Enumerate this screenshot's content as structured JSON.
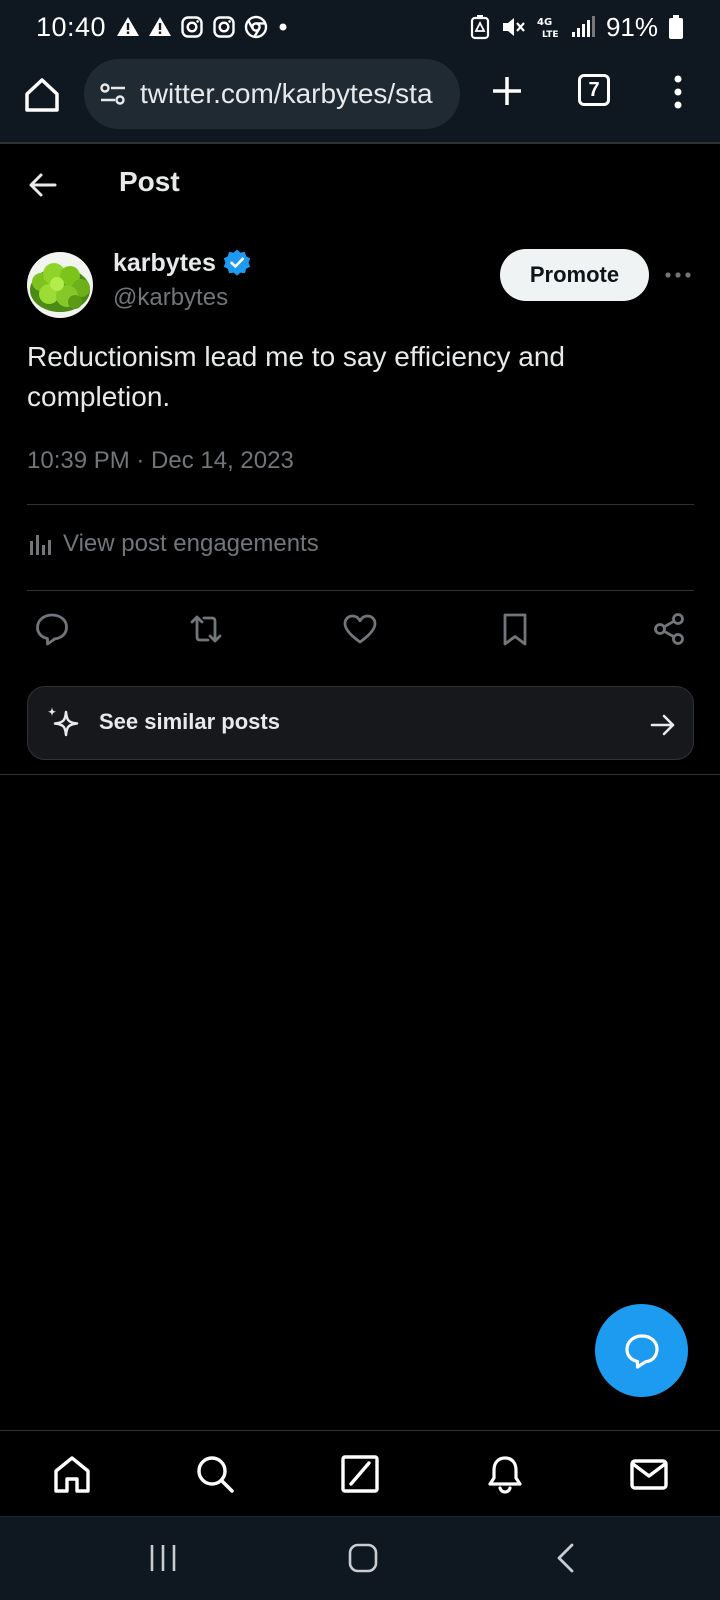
{
  "status_bar": {
    "time": "10:40",
    "battery": "91%"
  },
  "browser": {
    "url": "twitter.com/karbytes/sta",
    "tab_count": "7"
  },
  "header": {
    "title": "Post"
  },
  "post": {
    "author_name": "karbytes",
    "author_handle": "@karbytes",
    "promote_label": "Promote",
    "text": "Reductionism lead me to say efficiency and completion.",
    "timestamp": "10:39 PM · Dec 14, 2023",
    "engagements_label": "View post engagements",
    "similar_label": "See similar posts"
  },
  "colors": {
    "accent": "#1d9bf0",
    "background": "#000000",
    "secondary_text": "#71767b"
  },
  "icons": {
    "status": [
      "warning-icon",
      "warning-icon",
      "instagram-icon",
      "instagram-icon",
      "chrome-icon",
      "dot-icon",
      "battery-saver-icon",
      "mute-icon",
      "lte-icon",
      "signal-icon",
      "battery-icon"
    ],
    "actions": [
      "reply-icon",
      "repost-icon",
      "like-icon",
      "bookmark-icon",
      "share-icon"
    ],
    "nav": [
      "home-icon",
      "search-icon",
      "grok-icon",
      "notifications-icon",
      "messages-icon"
    ]
  }
}
